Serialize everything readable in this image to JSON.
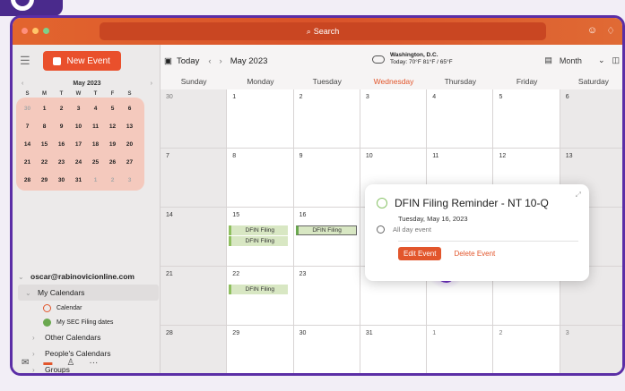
{
  "titlebar": {
    "search_label": "Search",
    "traffic_colors": [
      "#ff5f57",
      "#febc2e",
      "#28c840"
    ]
  },
  "sidebar": {
    "new_event_label": "New Event",
    "mini_calendar": {
      "title": "May 2023",
      "weekdays": [
        "S",
        "M",
        "T",
        "W",
        "T",
        "F",
        "S"
      ],
      "weeks": [
        [
          "30",
          "1",
          "2",
          "3",
          "4",
          "5",
          "6"
        ],
        [
          "7",
          "8",
          "9",
          "10",
          "11",
          "12",
          "13"
        ],
        [
          "14",
          "15",
          "16",
          "17",
          "18",
          "19",
          "20"
        ],
        [
          "21",
          "22",
          "23",
          "24",
          "25",
          "26",
          "27"
        ],
        [
          "28",
          "29",
          "30",
          "31",
          "1",
          "2",
          "3"
        ]
      ]
    },
    "account": "oscar@rabinovicionline.com",
    "my_calendars_label": "My Calendars",
    "calendars": [
      {
        "name": "Calendar",
        "color": "#e2562c"
      },
      {
        "name": "My SEC Filing dates",
        "color": "#6aa84f"
      }
    ],
    "groups": [
      "Other Calendars",
      "People's Calendars",
      "Groups"
    ]
  },
  "toolbar": {
    "today_label": "Today",
    "month_label": "May 2023",
    "weather_location": "Washington, D.C.",
    "weather_detail": "Today: 70°F 81°F / 65°F",
    "view_label": "Month"
  },
  "calendar": {
    "weekdays": [
      "Sunday",
      "Monday",
      "Tuesday",
      "Wednesday",
      "Thursday",
      "Friday",
      "Saturday"
    ],
    "weeks": [
      [
        "30",
        "1",
        "2",
        "3",
        "4",
        "5",
        "6"
      ],
      [
        "7",
        "8",
        "9",
        "10",
        "11",
        "12",
        "13"
      ],
      [
        "14",
        "15",
        "16",
        "17",
        "18",
        "19",
        "20"
      ],
      [
        "21",
        "22",
        "23",
        "24",
        "25",
        "26",
        "27"
      ],
      [
        "28",
        "29",
        "30",
        "31",
        "1",
        "2",
        "3"
      ]
    ],
    "events": {
      "may15_a": "DFIN Filing",
      "may15_b": "DFIN Filing",
      "may16": "DFIN Filing",
      "may22": "DFIN Filing"
    }
  },
  "popover": {
    "title": "DFIN Filing Reminder - NT 10-Q",
    "date": "Tuesday, May 16, 2023",
    "allday": "All day event",
    "edit_label": "Edit Event",
    "delete_label": "Delete Event"
  }
}
